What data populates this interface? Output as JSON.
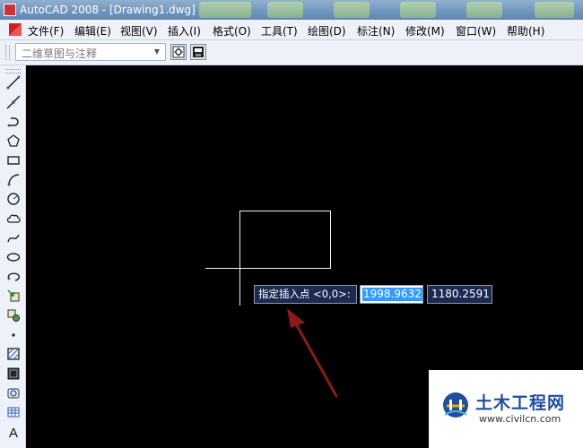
{
  "window": {
    "title": "AutoCAD 2008 - [Drawing1.dwg]"
  },
  "menubar": {
    "items": [
      "文件(F)",
      "编辑(E)",
      "视图(V)",
      "插入(I)",
      "格式(O)",
      "工具(T)",
      "绘图(D)",
      "标注(N)",
      "修改(M)",
      "窗口(W)",
      "帮助(H)"
    ]
  },
  "toolbar": {
    "workspace_value": "二维草图与注释"
  },
  "draw_tools": [
    "line-icon",
    "construction-line-icon",
    "polyline-icon",
    "polygon-icon",
    "rectangle-icon",
    "arc-icon",
    "circle-icon",
    "revision-cloud-icon",
    "spline-icon",
    "ellipse-icon",
    "ellipse-arc-icon",
    "insert-block-icon",
    "make-block-icon",
    "point-icon",
    "hatch-icon",
    "gradient-icon",
    "region-icon",
    "table-icon",
    "multiline-text-icon"
  ],
  "dynamic_input": {
    "prompt": "指定插入点 <0,0>:",
    "x_value": "1998.9632",
    "y_value": "1180.2591"
  },
  "watermark": {
    "title": "土木工程网",
    "url": "www.civilcn.com"
  },
  "colors": {
    "canvas": "#000000",
    "arrow": "#8b1a1a",
    "tooltip_bg": "#1c2a52",
    "selection": "#3399ff"
  }
}
